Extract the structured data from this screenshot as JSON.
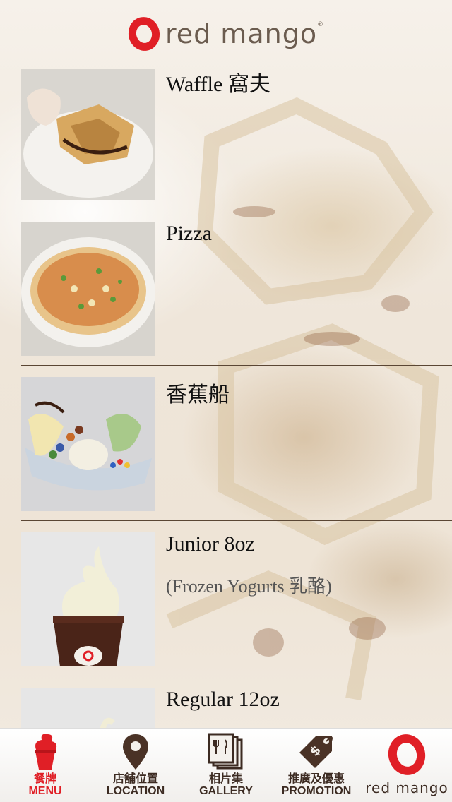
{
  "header": {
    "brand": "red mango",
    "registered_mark": "®"
  },
  "menu_items": [
    {
      "title": "Waffle 窩夫",
      "subtitle": "",
      "image": "waffle-with-frozen-yogurt"
    },
    {
      "title": "Pizza",
      "subtitle": "",
      "image": "pizza"
    },
    {
      "title": "香蕉船",
      "subtitle": "",
      "image": "banana-split"
    },
    {
      "title": "Junior 8oz",
      "subtitle": "(Frozen Yogurts 乳酪)",
      "image": "frozen-yogurt-cup"
    },
    {
      "title": "Regular 12oz",
      "subtitle": "",
      "image": "frozen-yogurt-cup"
    }
  ],
  "tabbar": {
    "menu": {
      "cn": "餐牌",
      "en": "MENU",
      "icon": "ice-cream-icon"
    },
    "location": {
      "cn": "店舖位置",
      "en": "LOCATION",
      "icon": "map-pin-icon"
    },
    "gallery": {
      "cn": "相片集",
      "en": "GALLERY",
      "icon": "photo-stack-icon"
    },
    "promotion": {
      "cn": "推廣及優惠",
      "en": "PROMOTION",
      "icon": "price-tag-icon"
    },
    "brand": {
      "text": "red mango"
    }
  },
  "colors": {
    "accent": "#e01f26",
    "brown": "#3c2b22",
    "divider": "#5a4634"
  }
}
